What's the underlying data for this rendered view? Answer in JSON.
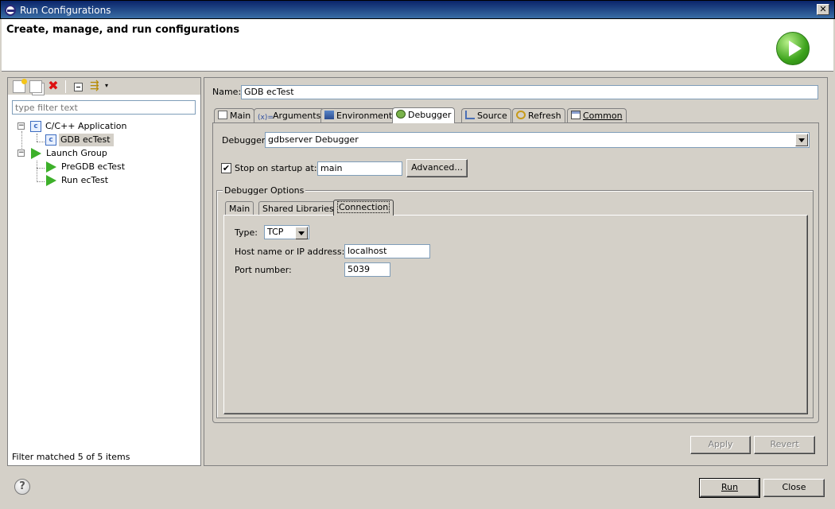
{
  "window": {
    "title": "Run Configurations",
    "close_glyph": "✕"
  },
  "header": {
    "title": "Create, manage, and run configurations",
    "run_icon": "run-icon"
  },
  "left": {
    "filter_placeholder": "type filter text",
    "tree": [
      {
        "label": "C/C++ Application",
        "expander": "−",
        "icon": "c-app-icon"
      },
      {
        "label": "GDB ecTest",
        "icon": "c-app-icon",
        "selected": true
      },
      {
        "label": "Launch Group",
        "expander": "−",
        "icon": "launch-icon"
      },
      {
        "label": "PreGDB ecTest",
        "icon": "launch-icon"
      },
      {
        "label": "Run ecTest",
        "icon": "launch-icon"
      }
    ],
    "filter_status": "Filter matched 5 of 5 items"
  },
  "config": {
    "name_label": "Name:",
    "name_value": "GDB ecTest",
    "tabs": [
      "Main",
      "Arguments",
      "Environment",
      "Debugger",
      "Source",
      "Refresh",
      "Common"
    ],
    "active_tab": "Debugger"
  },
  "debugger": {
    "label": "Debugger:",
    "value": "gdbserver Debugger",
    "stop_label": "Stop on startup at:",
    "stop_checked": true,
    "check_glyph": "✔",
    "stop_value": "main",
    "advanced_label": "Advanced...",
    "options_label": "Debugger Options",
    "inner_tabs": [
      "Main",
      "Shared Libraries",
      "Connection"
    ],
    "active_inner_tab": "Connection",
    "type_label": "Type:",
    "type_value": "TCP",
    "host_label": "Host name or IP address:",
    "host_value": "localhost",
    "port_label": "Port number:",
    "port_value": "5039"
  },
  "buttons": {
    "apply": "Apply",
    "revert": "Revert",
    "run": "Run",
    "close": "Close",
    "help": "?"
  }
}
